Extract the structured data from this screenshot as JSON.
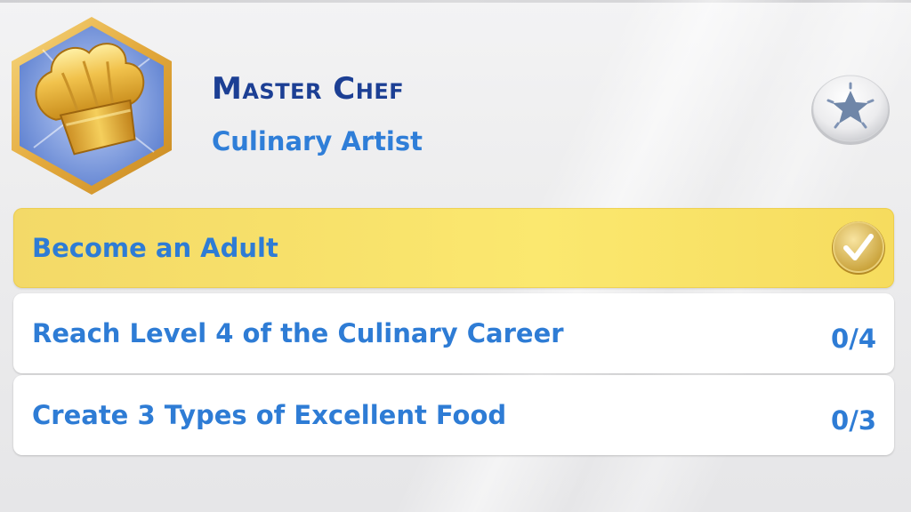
{
  "aspiration": {
    "title": "Master Chef",
    "category": "Culinary Artist",
    "badge_icon": "chef-hat-icon",
    "favorite_icon": "star-icon"
  },
  "goals": [
    {
      "label": "Become an Adult",
      "completed": true,
      "status_icon": "checkmark-icon"
    },
    {
      "label": "Reach Level 4 of the Culinary Career",
      "completed": false,
      "progress": "0/4"
    },
    {
      "label": "Create 3 Types of Excellent Food",
      "completed": false,
      "progress": "0/3"
    }
  ],
  "colors": {
    "title": "#1c3f94",
    "text": "#2e7cd5",
    "completed_row": "#f7e06a",
    "badge_frame": "#e9b84a",
    "badge_fill": "#6f8fd6",
    "star": "#6f86a8"
  }
}
